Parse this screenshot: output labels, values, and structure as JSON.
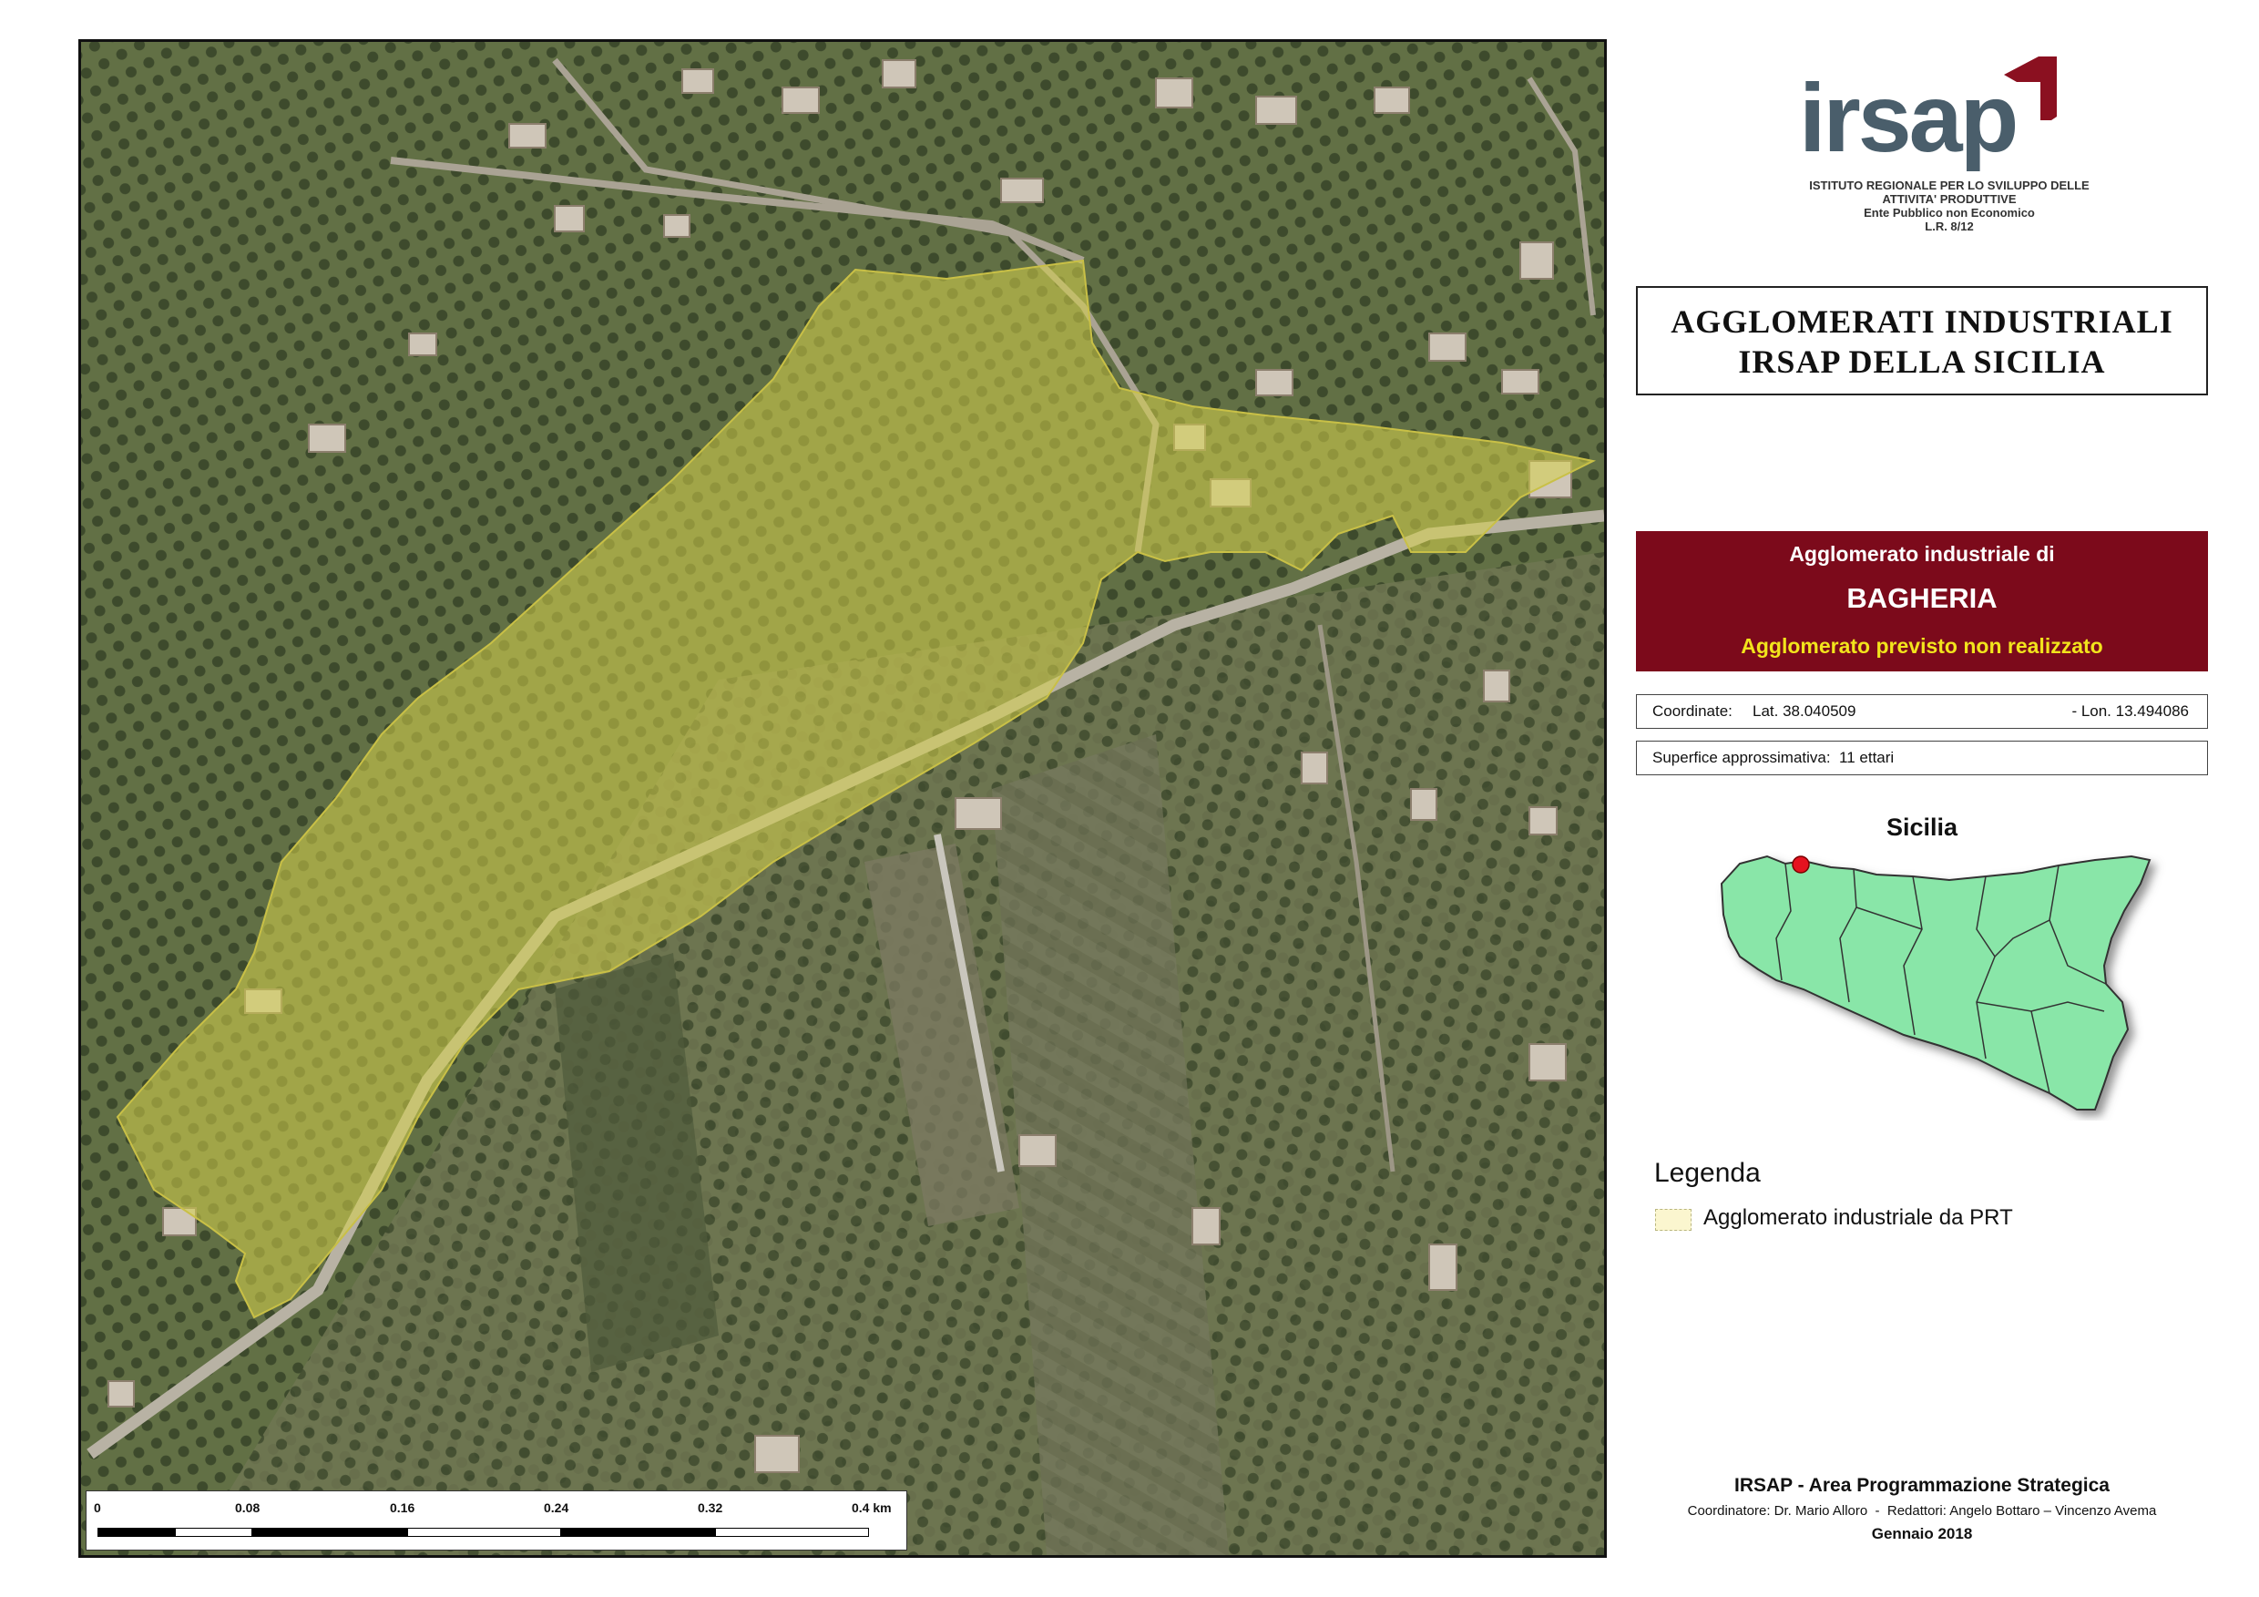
{
  "org": {
    "logo_text": "irsap",
    "line1": "ISTITUTO REGIONALE PER LO SVILUPPO DELLE",
    "line2": "ATTIVITA' PRODUTTIVE",
    "line3": "Ente Pubblico non Economico",
    "line4": "L.R. 8/12"
  },
  "title": {
    "line1": "AGGLOMERATI INDUSTRIALI",
    "line2": "IRSAP DELLA SICILIA"
  },
  "agglomerato": {
    "label": "Agglomerato industriale di",
    "name": "BAGHERIA",
    "status": "Agglomerato previsto non realizzato"
  },
  "coordinates": {
    "label": "Coordinate:",
    "lat": "Lat. 38.040509",
    "lon": "- Lon. 13.494086"
  },
  "area": {
    "text": "Superfice approssimativa:  11 ettari"
  },
  "inset_map": {
    "label": "Sicilia",
    "fill_color": "#89e6a8",
    "marker_color": "#e5121f"
  },
  "legend": {
    "title": "Legenda",
    "items": [
      {
        "label": "Agglomerato industriale da PRT",
        "swatch_color": "#fbf6cf"
      }
    ]
  },
  "scale": {
    "ticks": [
      "0",
      "0.08",
      "0.16",
      "0.24",
      "0.32",
      "0.4 km"
    ]
  },
  "footer": {
    "title": "IRSAP - Area Programmazione Strategica",
    "credits": "Coordinatore: Dr. Mario Alloro  -  Redattori: Angelo Bottaro – Vincenzo Avema",
    "date": "Gennaio 2018"
  },
  "colors": {
    "brand_red": "#7c0a1b",
    "brand_slate": "#4a5e6b",
    "status_yellow": "#f2e41c",
    "overlay_yellow": "#d6d24a"
  }
}
